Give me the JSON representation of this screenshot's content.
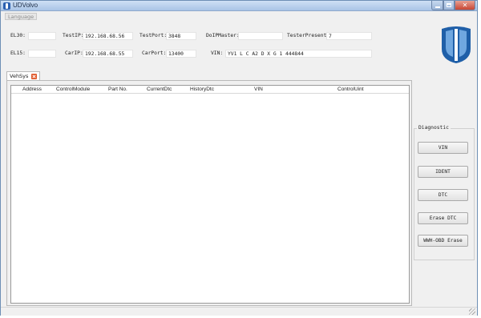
{
  "window": {
    "title": "UDVolvo"
  },
  "menu": {
    "items": [
      {
        "label": "Language"
      }
    ]
  },
  "connection": {
    "el30": {
      "label": "EL30:",
      "value": ""
    },
    "test_ip": {
      "label": "TestIP:",
      "value": "192.168.68.56"
    },
    "test_port": {
      "label": "TestPort:",
      "value": "3848"
    },
    "doip_master": {
      "label": "DoIPMaster:",
      "value": ""
    },
    "tester_present": {
      "label": "TesterPresent:",
      "value": "7"
    },
    "el15": {
      "label": "EL15:",
      "value": ""
    },
    "car_ip": {
      "label": "CarIP:",
      "value": "192.168.68.55"
    },
    "car_port": {
      "label": "CarPort:",
      "value": "13400"
    },
    "vin": {
      "label": "VIN:",
      "value": "YV1 L C A2 D X G 1 444844"
    }
  },
  "tabs": [
    {
      "label": "VehSys"
    }
  ],
  "table": {
    "columns": [
      "Address",
      "ControlModule",
      "Part No.",
      "CurrentDtc",
      "HistoryDtc",
      "VIN",
      "ControlUint"
    ],
    "rows": []
  },
  "diagnostic": {
    "title": "Diagnostic",
    "buttons": [
      "VIN",
      "IDENT",
      "DTC",
      "Erase DTC",
      "WWH-OBD Erase"
    ]
  },
  "colors": {
    "logo_blue": "#1f5fa8",
    "logo_light": "#6fa7e0",
    "tab_close": "#e0592c"
  }
}
